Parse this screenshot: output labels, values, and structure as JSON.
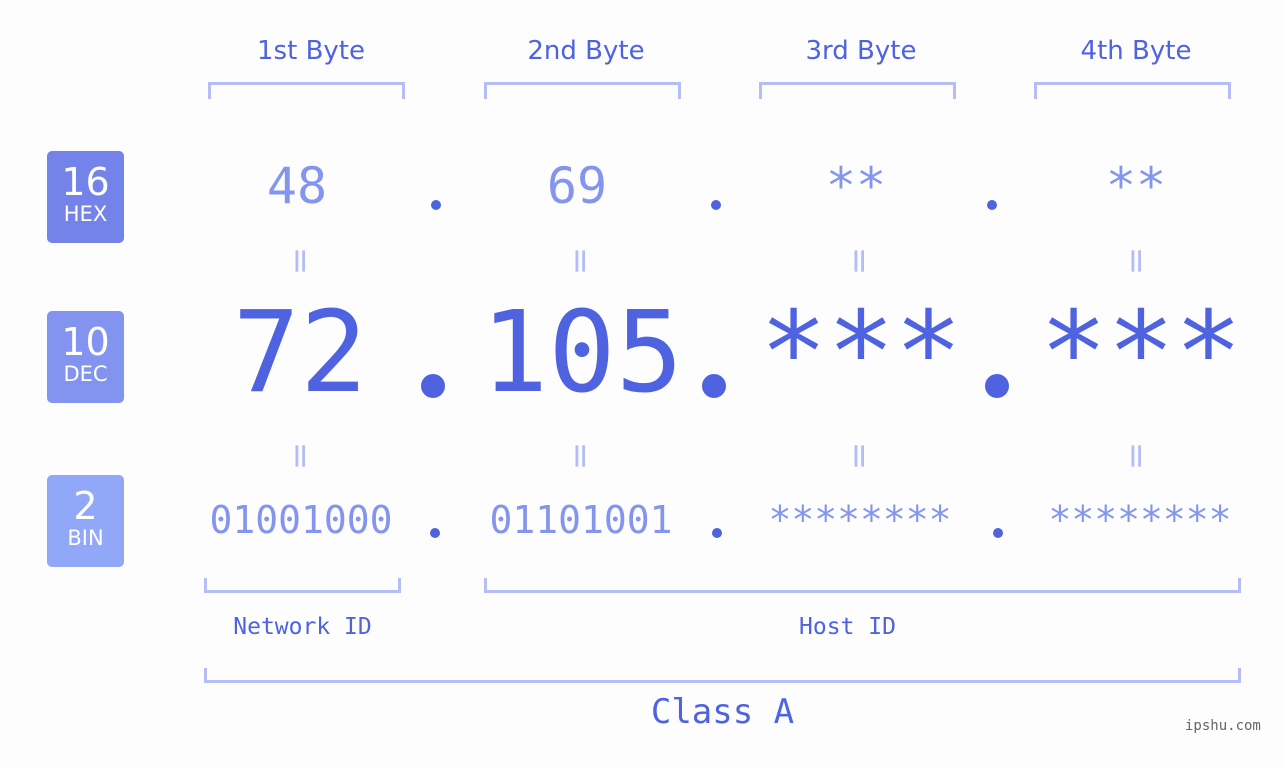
{
  "bytes": [
    {
      "label": "1st Byte",
      "hex": "48",
      "dec": "72",
      "bin": "01001000"
    },
    {
      "label": "2nd Byte",
      "hex": "69",
      "dec": "105",
      "bin": "01101001"
    },
    {
      "label": "3rd Byte",
      "hex": "**",
      "dec": "***",
      "bin": "********"
    },
    {
      "label": "4th Byte",
      "hex": "**",
      "dec": "***",
      "bin": "********"
    }
  ],
  "bases": {
    "hex": {
      "number": "16",
      "label": "HEX",
      "color": "#7383ea"
    },
    "dec": {
      "number": "10",
      "label": "DEC",
      "color": "#8394f0"
    },
    "bin": {
      "number": "2",
      "label": "BIN",
      "color": "#91a8f8"
    }
  },
  "equals_symbol": "=",
  "sections": {
    "network": "Network ID",
    "host": "Host ID"
  },
  "class_label": "Class A",
  "watermark": "ipshu.com",
  "colors": {
    "accent": "#4f63e0",
    "light_accent": "#8495ed",
    "bracket": "#b4bdf6",
    "background": "#fcfdfc"
  }
}
